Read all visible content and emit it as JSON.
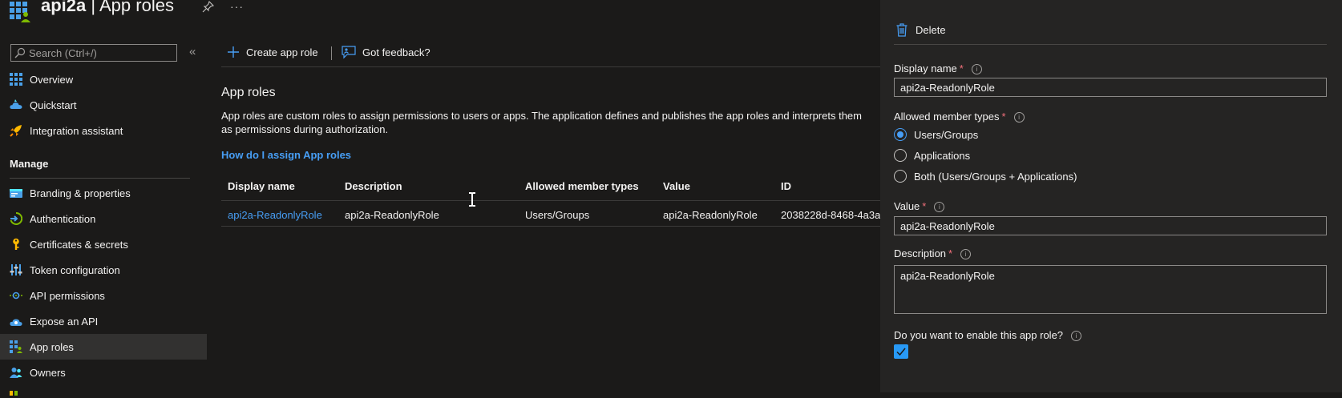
{
  "header": {
    "app_name": "api2a",
    "separator": " | ",
    "page_name": "App roles",
    "more_glyph": "···"
  },
  "sidebar": {
    "search_placeholder": "Search (Ctrl+/)",
    "collapse_glyph": "«",
    "items_top": [
      {
        "label": "Overview",
        "icon": "grid-overview-icon"
      },
      {
        "label": "Quickstart",
        "icon": "cloud-quickstart-icon"
      },
      {
        "label": "Integration assistant",
        "icon": "rocket-icon"
      }
    ],
    "section_label": "Manage",
    "items_manage": [
      {
        "label": "Branding & properties",
        "icon": "branding-icon"
      },
      {
        "label": "Authentication",
        "icon": "authentication-icon"
      },
      {
        "label": "Certificates & secrets",
        "icon": "key-icon"
      },
      {
        "label": "Token configuration",
        "icon": "token-config-icon"
      },
      {
        "label": "API permissions",
        "icon": "api-permissions-icon"
      },
      {
        "label": "Expose an API",
        "icon": "expose-api-icon"
      },
      {
        "label": "App roles",
        "icon": "app-roles-icon",
        "selected": true
      },
      {
        "label": "Owners",
        "icon": "owners-icon"
      }
    ]
  },
  "toolbar": {
    "create_label": "Create app role",
    "feedback_label": "Got feedback?"
  },
  "main": {
    "heading": "App roles",
    "description": "App roles are custom roles to assign permissions to users or apps. The application defines and publishes the app roles and interprets them as permissions during authorization.",
    "help_link": "How do I assign App roles",
    "table": {
      "columns": [
        "Display name",
        "Description",
        "Allowed member types",
        "Value",
        "ID"
      ],
      "rows": [
        [
          "api2a-ReadonlyRole",
          "api2a-ReadonlyRole",
          "Users/Groups",
          "api2a-ReadonlyRole",
          "2038228d-8468-4a3a"
        ]
      ]
    }
  },
  "panel": {
    "delete_label": "Delete",
    "display_name_label": "Display name",
    "display_name_value": "api2a-ReadonlyRole",
    "member_types_label": "Allowed member types",
    "member_types_options": [
      "Users/Groups",
      "Applications",
      "Both (Users/Groups + Applications)"
    ],
    "member_types_selected": "Users/Groups",
    "value_label": "Value",
    "value_value": "api2a-ReadonlyRole",
    "description_label": "Description",
    "description_value": "api2a-ReadonlyRole",
    "enable_label": "Do you want to enable this app role?",
    "enable_checked": true,
    "required_marker": "*",
    "info_glyph": "i"
  },
  "colors": {
    "background": "#1b1a19",
    "panel_background": "#252423",
    "link": "#479ef5",
    "accent": "#2899f5",
    "required": "#f1707b"
  }
}
